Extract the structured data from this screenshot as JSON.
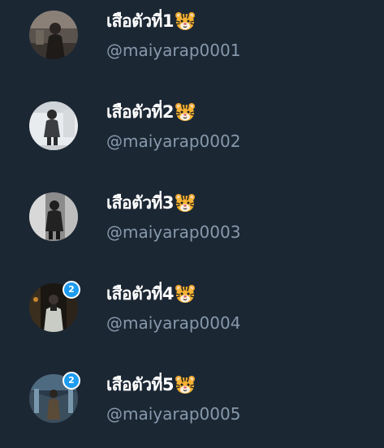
{
  "accounts": [
    {
      "display_name": "เสือตัวที่1",
      "emoji": "tiger-face-emoji",
      "handle": "@maiyarap0001",
      "avatar": "profile-photo",
      "badge": null
    },
    {
      "display_name": "เสือตัวที่2",
      "emoji": "tiger-face-emoji",
      "handle": "@maiyarap0002",
      "avatar": "profile-photo",
      "badge": null
    },
    {
      "display_name": "เสือตัวที่3",
      "emoji": "tiger-face-emoji",
      "handle": "@maiyarap0003",
      "avatar": "profile-photo",
      "badge": null
    },
    {
      "display_name": "เสือตัวที่4",
      "emoji": "tiger-face-emoji",
      "handle": "@maiyarap0004",
      "avatar": "profile-photo",
      "badge": "2"
    },
    {
      "display_name": "เสือตัวที่5",
      "emoji": "tiger-face-emoji",
      "handle": "@maiyarap0005",
      "avatar": "profile-photo",
      "badge": "2"
    }
  ],
  "colors": {
    "background": "#1c2734",
    "name_text": "#ffffff",
    "handle_text": "#8799ab",
    "badge": "#1d9bf0"
  }
}
